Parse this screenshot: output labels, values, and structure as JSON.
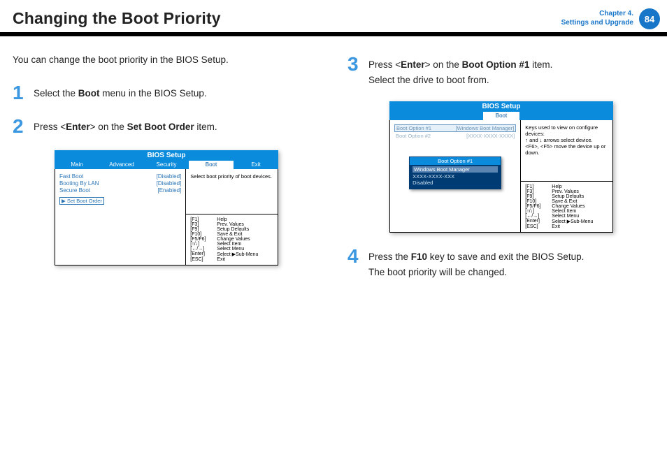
{
  "header": {
    "title": "Changing the Boot Priority",
    "chapter_line1": "Chapter 4.",
    "chapter_line2": "Settings and Upgrade",
    "page_num": "84"
  },
  "intro": "You can change the boot priority in the BIOS Setup.",
  "steps": {
    "s1_num": "1",
    "s1_a": "Select the ",
    "s1_b": "Boot",
    "s1_c": " menu in the BIOS Setup.",
    "s2_num": "2",
    "s2_a": "Press <",
    "s2_b": "Enter",
    "s2_c": "> on the ",
    "s2_d": "Set Boot Order",
    "s2_e": " item.",
    "s3_num": "3",
    "s3_a": "Press <",
    "s3_b": "Enter",
    "s3_c": "> on the ",
    "s3_d": "Boot Option #1",
    "s3_e": " item.",
    "s3_line2": "Select the drive to boot from.",
    "s4_num": "4",
    "s4_a": "Press the ",
    "s4_b": "F10",
    "s4_c": " key to save and exit the BIOS Setup.",
    "s4_line2": "The boot priority will be changed."
  },
  "bios1": {
    "title": "BIOS Setup",
    "tabs": {
      "t1": "Main",
      "t2": "Advanced",
      "t3": "Security",
      "t4": "Boot",
      "t5": "Exit"
    },
    "rows": {
      "r1k": "Fast Boot",
      "r1v": "[Disabled]",
      "r2k": "Booting By LAN",
      "r2v": "[Disabled]",
      "r3k": "Secure Boot",
      "r3v": "[Enabled]"
    },
    "setboot": "▶ Set Boot Order",
    "help": "Select boot priority of boot devices."
  },
  "bios2": {
    "title": "BIOS Setup",
    "tab": "Boot",
    "opt1k": "Boot Option  #1",
    "opt1v": "[Windows Boot Manager]",
    "opt2k": "Boot Option  #2",
    "opt2v": "[XXXX-XXXX-XXXX]",
    "popup_title": "Boot Option  #1",
    "popup_o1": "Windows Boot Manager",
    "popup_o2": "XXXX-XXXX-XXX",
    "popup_o3": "Disabled",
    "help_l1": "Keys used to view on configure devices:",
    "help_l2": "↑  and ↓  arrows select device.",
    "help_l3": "<F6>, <F5> move the device up or down."
  },
  "keys": {
    "k1a": "[F1]",
    "k1b": "Help",
    "k2a": "[F3]",
    "k2b": "Prev. Values",
    "k3a": "[F9]",
    "k3b": "Setup Defaults",
    "k4a": "[F10]",
    "k4b": "Save & Exit",
    "k5a": "[F5/F6]",
    "k5b": "Change Values",
    "k6a": "[↑/↓]",
    "k6b": "Select Item",
    "k7a": "[←/→]",
    "k7b": "Select Menu",
    "k8a": "[Enter]",
    "k8b": "Select ▶Sub-Menu",
    "k9a": "[ESC]",
    "k9b": "Exit"
  }
}
